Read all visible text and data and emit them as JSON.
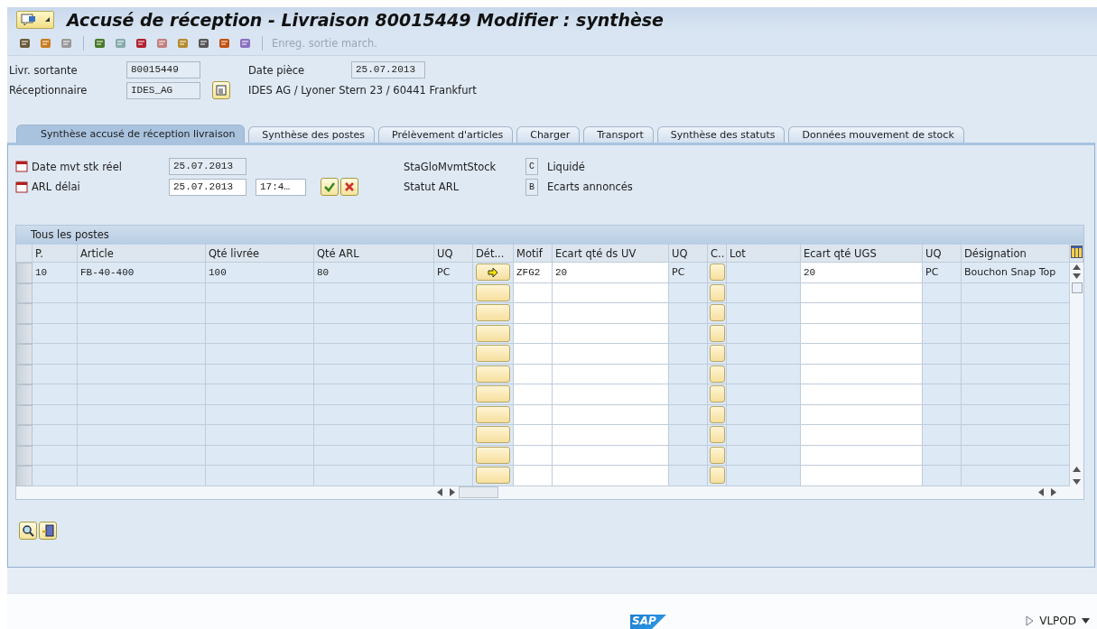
{
  "window": {
    "title": "Accusé de réception - Livraison 80015449 Modifier : synthèse"
  },
  "toolbar": {
    "disabled_action": "Enreg. sortie march."
  },
  "header": {
    "fields": [
      {
        "label": "Livr. sortante",
        "value": "80015449"
      },
      {
        "label": "Réceptionnaire",
        "value": "IDES_AG"
      }
    ],
    "date_label": "Date pièce",
    "date_value": "25.07.2013",
    "address": "IDES AG / Lyoner Stern 23 / 60441 Frankfurt"
  },
  "tabs": [
    {
      "label": "Synthèse accusé de réception livraison",
      "selected": true
    },
    {
      "label": "Synthèse des postes",
      "selected": false
    },
    {
      "label": "Prélèvement d'articles",
      "selected": false
    },
    {
      "label": "Charger",
      "selected": false
    },
    {
      "label": "Transport",
      "selected": false
    },
    {
      "label": "Synthèse des statuts",
      "selected": false
    },
    {
      "label": "Données mouvement de stock",
      "selected": false
    }
  ],
  "panel": {
    "dates": [
      {
        "label": "Date mvt stk réel",
        "value": "25.07.2013",
        "editable": false
      },
      {
        "label": "ARL délai",
        "value": "25.07.2013",
        "editable": true,
        "time": "17:4…"
      }
    ],
    "statuses": [
      {
        "label": "StaGloMvmtStock",
        "code": "C",
        "text": "Liquidé"
      },
      {
        "label": "Statut ARL",
        "code": "B",
        "text": "Ecarts annoncés"
      }
    ]
  },
  "table": {
    "title": "Tous les postes",
    "columns": [
      {
        "label": "P.",
        "kind": "text"
      },
      {
        "label": "Article",
        "kind": "text"
      },
      {
        "label": "Qté livrée",
        "kind": "text"
      },
      {
        "label": "Qté ARL",
        "kind": "text"
      },
      {
        "label": "UQ",
        "kind": "text"
      },
      {
        "label": "Dét...",
        "kind": "button"
      },
      {
        "label": "Motif",
        "kind": "input"
      },
      {
        "label": "Ecart qté ds UV",
        "kind": "input"
      },
      {
        "label": "UQ",
        "kind": "text"
      },
      {
        "label": "C..",
        "kind": "check"
      },
      {
        "label": "Lot",
        "kind": "text"
      },
      {
        "label": "Ecart qté UGS",
        "kind": "input"
      },
      {
        "label": "UQ",
        "kind": "text"
      },
      {
        "label": "Désignation",
        "kind": "text"
      }
    ],
    "rows": [
      {
        "p": "10",
        "article": "FB-40-400",
        "qty_delivered": "100",
        "qty_arl": "80",
        "unit": "PC",
        "has_detail": true,
        "reason": "ZFG2",
        "diff_sales": "20",
        "unit_sales": "PC",
        "checked": false,
        "diff_base": "20",
        "unit_base": "PC",
        "description": "Bouchon Snap Top"
      },
      {
        "has_detail": false,
        "checked": false
      },
      {
        "has_detail": false,
        "checked": false
      },
      {
        "has_detail": false,
        "checked": false
      },
      {
        "has_detail": false,
        "checked": false
      },
      {
        "has_detail": false,
        "checked": false
      },
      {
        "has_detail": false,
        "checked": false
      },
      {
        "has_detail": false,
        "checked": false
      },
      {
        "has_detail": false,
        "checked": false
      },
      {
        "has_detail": false,
        "checked": false
      },
      {
        "has_detail": false,
        "checked": false
      }
    ]
  },
  "footer": {
    "logo": "SAP",
    "transaction": "VLPOD"
  }
}
